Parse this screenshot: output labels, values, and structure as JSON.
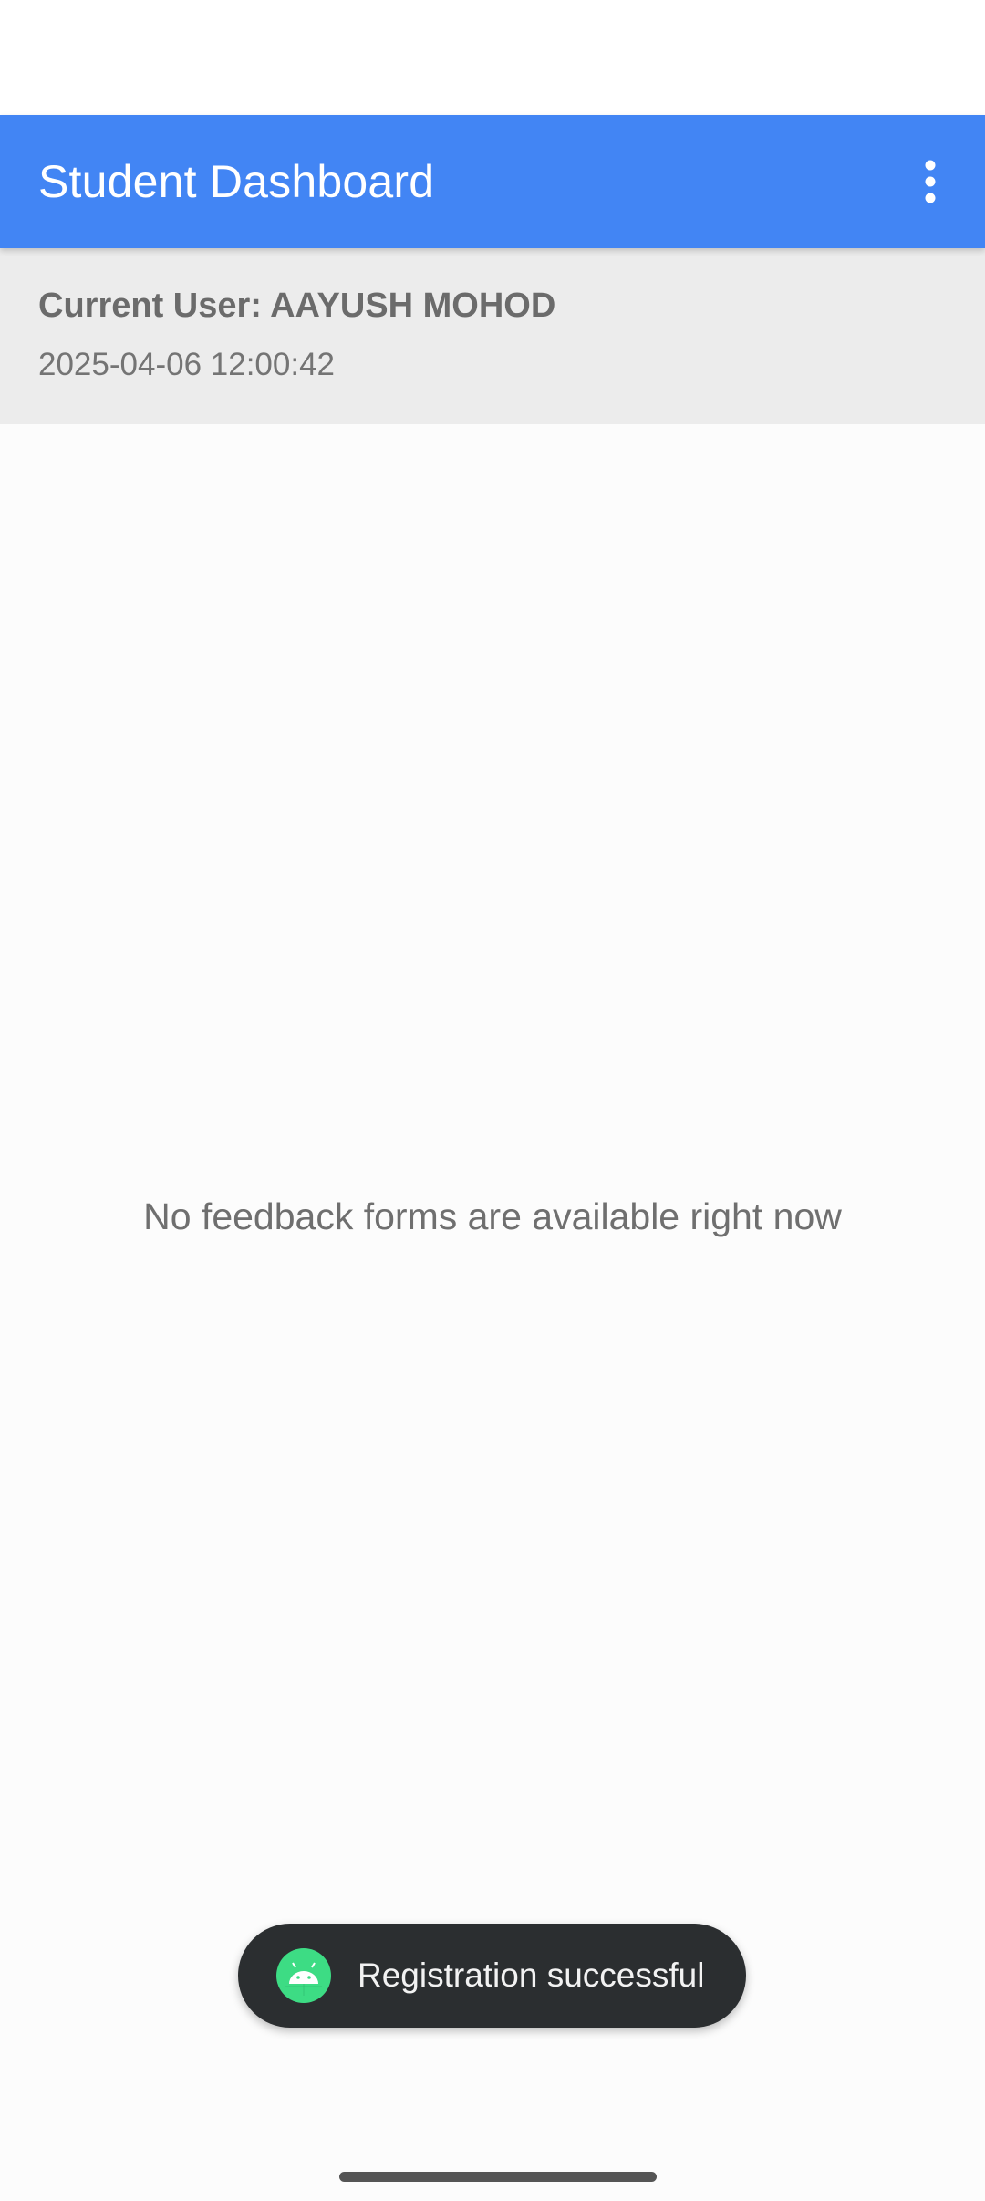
{
  "app_bar": {
    "title": "Student Dashboard",
    "menu_icon": "more-vertical-icon",
    "color": "#4285f4"
  },
  "user_panel": {
    "current_user": "Current User: AAYUSH MOHOD",
    "timestamp": "2025-04-06 12:00:42"
  },
  "content": {
    "empty_message": "No feedback forms are available right now"
  },
  "toast": {
    "icon": "android-icon",
    "message": "Registration successful"
  }
}
